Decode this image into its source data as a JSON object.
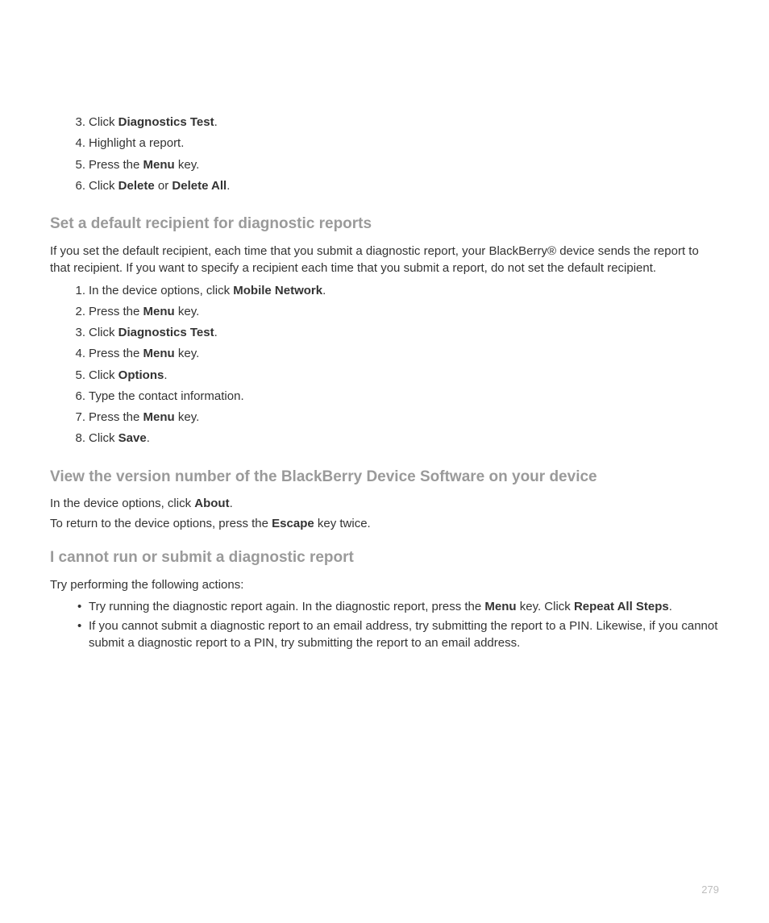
{
  "list1": {
    "start": 3,
    "items": [
      {
        "segs": [
          {
            "t": "Click "
          },
          {
            "t": "Diagnostics Test",
            "b": true
          },
          {
            "t": "."
          }
        ]
      },
      {
        "segs": [
          {
            "t": "Highlight a report."
          }
        ]
      },
      {
        "segs": [
          {
            "t": "Press the "
          },
          {
            "t": "Menu",
            "b": true
          },
          {
            "t": " key."
          }
        ]
      },
      {
        "segs": [
          {
            "t": "Click "
          },
          {
            "t": "Delete",
            "b": true
          },
          {
            "t": " or "
          },
          {
            "t": "Delete All",
            "b": true
          },
          {
            "t": "."
          }
        ]
      }
    ]
  },
  "section2": {
    "heading": "Set a default recipient for diagnostic reports",
    "intro": [
      "If you set the default recipient, each time that you submit a diagnostic report, your BlackBerry® device sends the report to that recipient. If you want to specify a recipient each time that you submit a report, do not set the default recipient."
    ],
    "list": {
      "start": 1,
      "items": [
        {
          "segs": [
            {
              "t": "In the device options, click "
            },
            {
              "t": "Mobile Network",
              "b": true
            },
            {
              "t": "."
            }
          ]
        },
        {
          "segs": [
            {
              "t": "Press the "
            },
            {
              "t": "Menu",
              "b": true
            },
            {
              "t": " key."
            }
          ]
        },
        {
          "segs": [
            {
              "t": "Click "
            },
            {
              "t": "Diagnostics Test",
              "b": true
            },
            {
              "t": "."
            }
          ]
        },
        {
          "segs": [
            {
              "t": "Press the "
            },
            {
              "t": "Menu",
              "b": true
            },
            {
              "t": " key."
            }
          ]
        },
        {
          "segs": [
            {
              "t": "Click "
            },
            {
              "t": "Options",
              "b": true
            },
            {
              "t": "."
            }
          ]
        },
        {
          "segs": [
            {
              "t": "Type the contact information."
            }
          ]
        },
        {
          "segs": [
            {
              "t": "Press the "
            },
            {
              "t": "Menu",
              "b": true
            },
            {
              "t": " key."
            }
          ]
        },
        {
          "segs": [
            {
              "t": "Click "
            },
            {
              "t": "Save",
              "b": true
            },
            {
              "t": "."
            }
          ]
        }
      ]
    }
  },
  "section3": {
    "heading": "View the version number of the BlackBerry Device Software on your device",
    "paras": [
      {
        "segs": [
          {
            "t": "In the device options, click "
          },
          {
            "t": "About",
            "b": true
          },
          {
            "t": "."
          }
        ]
      },
      {
        "segs": [
          {
            "t": "To return to the device options, press the "
          },
          {
            "t": "Escape",
            "b": true
          },
          {
            "t": " key twice."
          }
        ]
      }
    ]
  },
  "section4": {
    "heading": "I cannot run or submit a diagnostic report",
    "intro": "Try performing the following actions:",
    "bullets": [
      {
        "segs": [
          {
            "t": "Try running the diagnostic report again. In the diagnostic report, press the "
          },
          {
            "t": "Menu",
            "b": true
          },
          {
            "t": " key. Click "
          },
          {
            "t": "Repeat All Steps",
            "b": true
          },
          {
            "t": "."
          }
        ]
      },
      {
        "segs": [
          {
            "t": "If you cannot submit a diagnostic report to an email address, try submitting the report to a PIN. Likewise, if you cannot submit a diagnostic report to a PIN, try submitting the report to an email address."
          }
        ]
      }
    ]
  },
  "page_number": "279"
}
